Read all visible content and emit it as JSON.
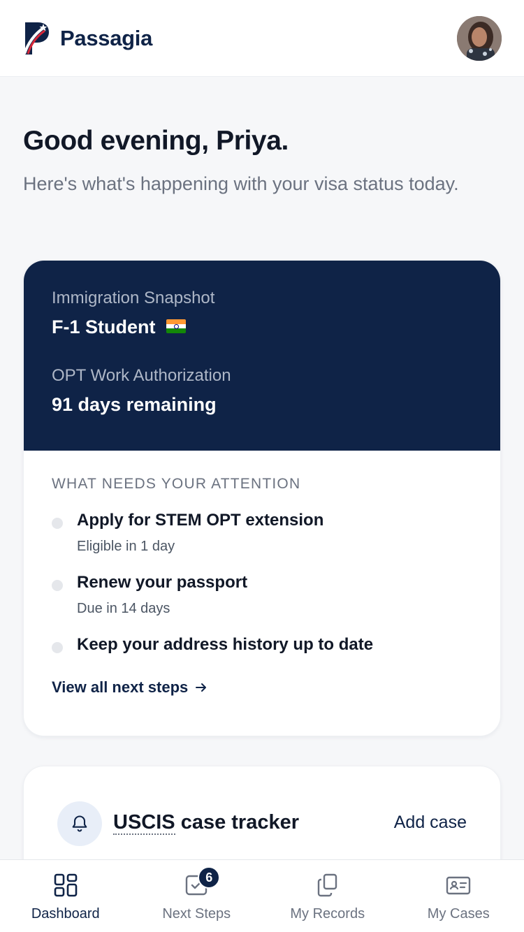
{
  "app": {
    "name": "Passagia"
  },
  "greeting": {
    "title": "Good evening, Priya.",
    "subtitle": "Here's what's happening with your visa status today."
  },
  "snapshot": {
    "label": "Immigration Snapshot",
    "status": "F-1 Student",
    "opt_label": "OPT Work Authorization",
    "opt_value": "91 days remaining"
  },
  "attention": {
    "title": "WHAT NEEDS YOUR ATTENTION",
    "items": [
      {
        "title": "Apply for STEM OPT extension",
        "subtitle": "Eligible in 1 day"
      },
      {
        "title": "Renew your passport",
        "subtitle": "Due in 14 days"
      },
      {
        "title": "Keep your address history up to date",
        "subtitle": ""
      }
    ],
    "view_all": "View all next steps"
  },
  "tracker": {
    "title_abbr": "USCIS",
    "title_rest": " case tracker",
    "add_case": "Add case"
  },
  "nav": {
    "items": [
      {
        "label": "Dashboard",
        "icon": "grid-icon",
        "active": true
      },
      {
        "label": "Next Steps",
        "icon": "checkbox-icon",
        "badge": "6"
      },
      {
        "label": "My Records",
        "icon": "copy-icon"
      },
      {
        "label": "My Cases",
        "icon": "id-card-icon"
      }
    ]
  },
  "colors": {
    "brand_navy": "#0f2347",
    "muted_text": "#6b7280"
  }
}
